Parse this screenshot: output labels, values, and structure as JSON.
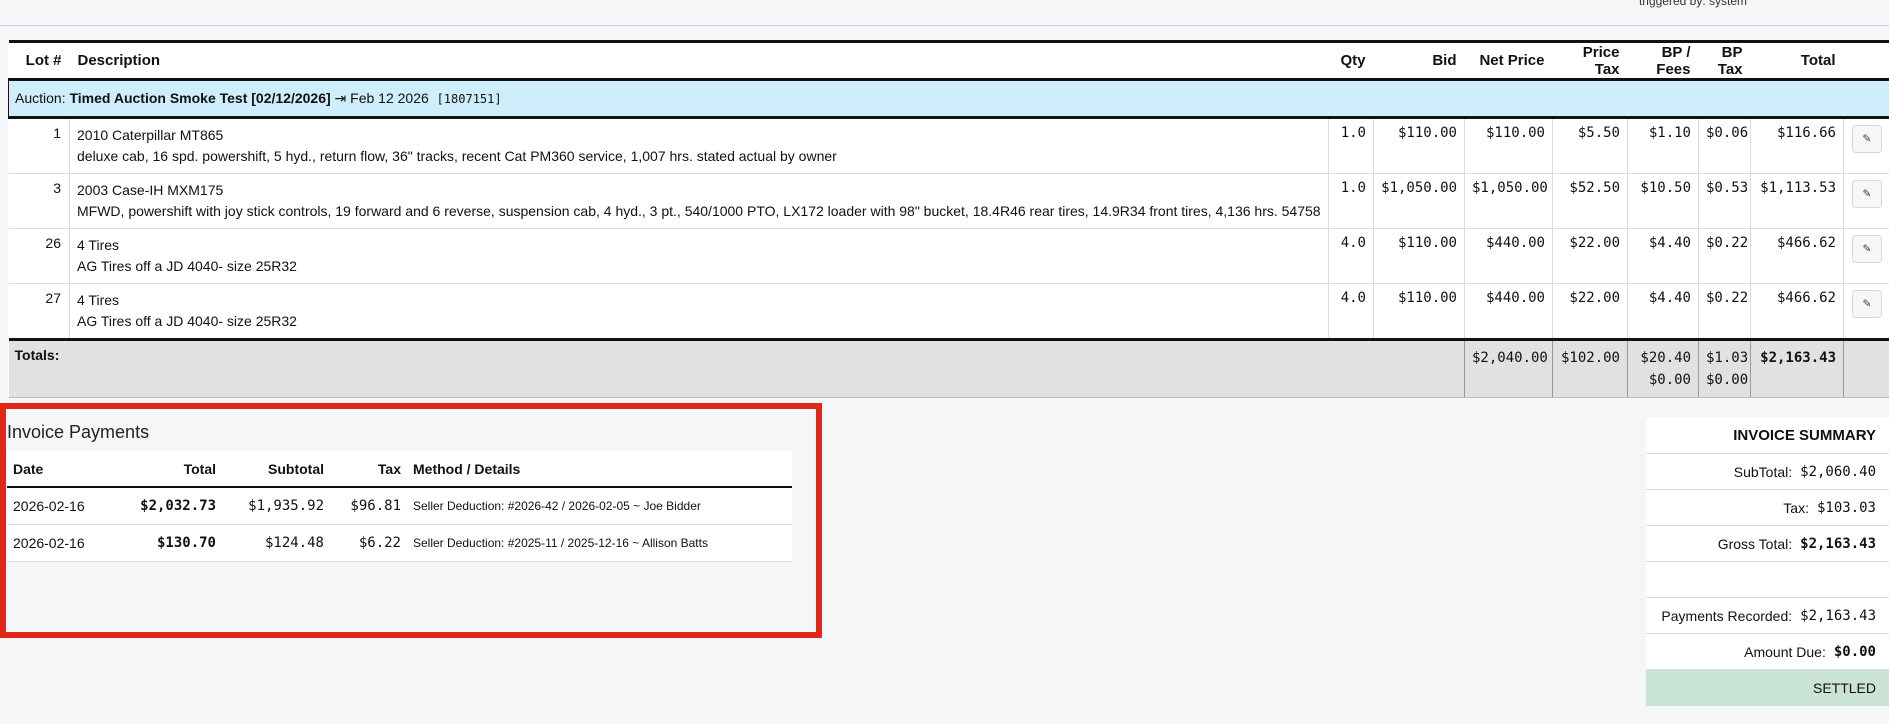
{
  "header": {
    "triggered_by": "triggered by: system"
  },
  "columns": {
    "lot": "Lot #",
    "description": "Description",
    "qty": "Qty",
    "bid": "Bid",
    "net_price": "Net Price",
    "price_tax": "Price Tax",
    "bp_fees": "BP / Fees",
    "bp_tax": "BP Tax",
    "total": "Total"
  },
  "auction": {
    "prefix": "Auction:",
    "name": "Timed Auction Smoke Test [02/12/2026]",
    "arrow": "⇥",
    "date": "Feb 12 2026",
    "id": "[1807151]"
  },
  "lots": [
    {
      "lot": "1",
      "title": "2010 Caterpillar MT865",
      "details": "deluxe cab, 16 spd. powershift, 5 hyd., return flow, 36\" tracks, recent Cat PM360 service, 1,007 hrs. stated actual by owner",
      "qty": "1.0",
      "bid": "$110.00",
      "net": "$110.00",
      "ptax": "$5.50",
      "bp": "$1.10",
      "bptax": "$0.06",
      "total": "$116.66"
    },
    {
      "lot": "3",
      "title": "2003 Case-IH MXM175",
      "details": "MFWD, powershift with joy stick controls, 19 forward and 6 reverse, suspension cab, 4 hyd., 3 pt., 540/1000 PTO, LX172 loader with 98\" bucket, 18.4R46 rear tires, 14.9R34 front tires, 4,136 hrs. 54758",
      "qty": "1.0",
      "bid": "$1,050.00",
      "net": "$1,050.00",
      "ptax": "$52.50",
      "bp": "$10.50",
      "bptax": "$0.53",
      "total": "$1,113.53"
    },
    {
      "lot": "26",
      "title": "4 Tires",
      "details": "AG Tires off a JD 4040- size 25R32",
      "qty": "4.0",
      "bid": "$110.00",
      "net": "$440.00",
      "ptax": "$22.00",
      "bp": "$4.40",
      "bptax": "$0.22",
      "total": "$466.62"
    },
    {
      "lot": "27",
      "title": "4 Tires",
      "details": "AG Tires off a JD 4040- size 25R32",
      "qty": "4.0",
      "bid": "$110.00",
      "net": "$440.00",
      "ptax": "$22.00",
      "bp": "$4.40",
      "bptax": "$0.22",
      "total": "$466.62"
    }
  ],
  "totals": {
    "label": "Totals:",
    "net": "$2,040.00",
    "ptax": "$102.00",
    "bp1": "$20.40",
    "bp2": "$0.00",
    "bptax1": "$1.03",
    "bptax2": "$0.00",
    "total": "$2,163.43"
  },
  "payments": {
    "title": "Invoice Payments",
    "columns": {
      "date": "Date",
      "total": "Total",
      "subtotal": "Subtotal",
      "tax": "Tax",
      "method": "Method / Details"
    },
    "rows": [
      {
        "date": "2026-02-16",
        "total": "$2,032.73",
        "subtotal": "$1,935.92",
        "tax": "$96.81",
        "method": "Seller Deduction: #2026-42 / 2026-02-05 ~ Joe Bidder"
      },
      {
        "date": "2026-02-16",
        "total": "$130.70",
        "subtotal": "$124.48",
        "tax": "$6.22",
        "method": "Seller Deduction: #2025-11 / 2025-12-16 ~ Allison Batts"
      }
    ]
  },
  "summary": {
    "title": "INVOICE SUMMARY",
    "subtotal_label": "SubTotal:",
    "subtotal": "$2,060.40",
    "tax_label": "Tax:",
    "tax": "$103.03",
    "gross_label": "Gross Total:",
    "gross": "$2,163.43",
    "payments_label": "Payments Recorded:",
    "payments": "$2,163.43",
    "due_label": "Amount Due:",
    "due": "$0.00",
    "status": "SETTLED"
  },
  "icons": {
    "edit": "edit-icon"
  }
}
